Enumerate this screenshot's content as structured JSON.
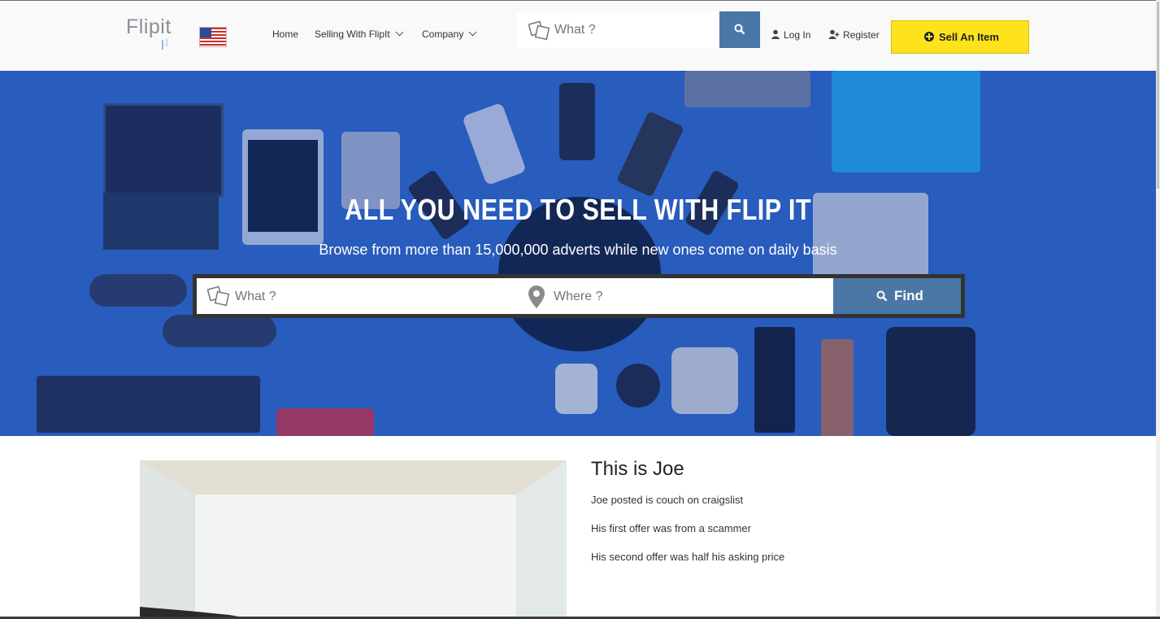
{
  "header": {
    "logo_text": "Flipit",
    "nav": [
      {
        "label": "Home"
      },
      {
        "label": "Selling With FlipIt"
      },
      {
        "label": "Company"
      }
    ],
    "search_placeholder": "What ?",
    "login_label": "Log In",
    "register_label": "Register",
    "sell_label": "Sell An Item"
  },
  "hero": {
    "title": "ALL YOU NEED TO SELL WITH FLIP IT",
    "subtitle": "Browse from more than 15,000,000 adverts while new ones come on daily basis",
    "what_placeholder": "What ?",
    "where_placeholder": "Where ?",
    "find_label": "Find"
  },
  "content": {
    "title": "This is Joe",
    "paragraphs": [
      "Joe posted is couch on craigslist",
      "His first offer was from a scammer",
      "His second offer was half his asking price"
    ]
  },
  "colors": {
    "accent_blue": "#4b77a6",
    "sell_yellow": "#fde21c",
    "hero_blue": "#2d66c6"
  },
  "icons": [
    "flag-us-icon",
    "chevron-down-icon",
    "box-icon",
    "search-icon",
    "user-icon",
    "add-user-icon",
    "plus-circle-icon",
    "map-pin-icon"
  ]
}
